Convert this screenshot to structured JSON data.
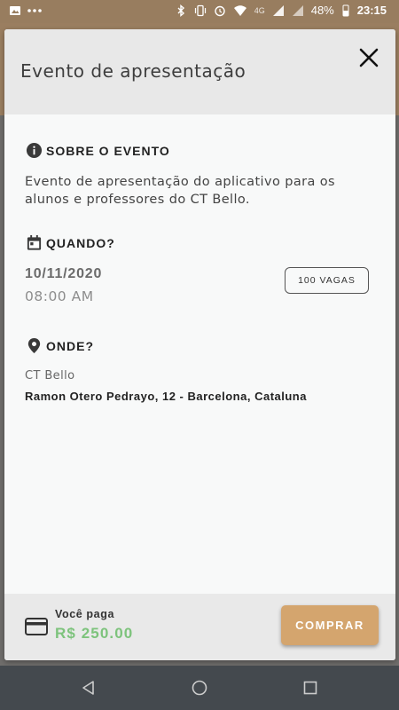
{
  "status_bar": {
    "network": "4G",
    "battery": "48%",
    "time": "23:15"
  },
  "modal": {
    "title": "Evento de apresentação",
    "about": {
      "heading": "SOBRE O EVENTO",
      "text": "Evento de apresentação do aplicativo para os alunos e professores do CT Bello."
    },
    "when": {
      "heading": "QUANDO?",
      "date": "10/11/2020",
      "time": "08:00 AM",
      "slots_badge": "100 VAGAS"
    },
    "where": {
      "heading": "ONDE?",
      "place_name": "CT Bello",
      "address": "Ramon Otero Pedrayo, 12 - Barcelona, Cataluna"
    }
  },
  "footer": {
    "pay_label": "Você paga",
    "price": "R$ 250.00",
    "buy_label": "COMPRAR"
  },
  "colors": {
    "accent": "#d4a56e",
    "price_green": "#7dc37c",
    "status_bar": "#987d5f",
    "nav_bar": "#44494e"
  },
  "icons": {
    "status_left": [
      "image-icon",
      "more-dots-icon"
    ],
    "status_right": [
      "bluetooth-icon",
      "vibrate-icon",
      "alarm-icon",
      "wifi-icon",
      "signal-icon",
      "battery-icon"
    ],
    "nav": [
      "back-icon",
      "home-icon",
      "recents-icon"
    ]
  }
}
